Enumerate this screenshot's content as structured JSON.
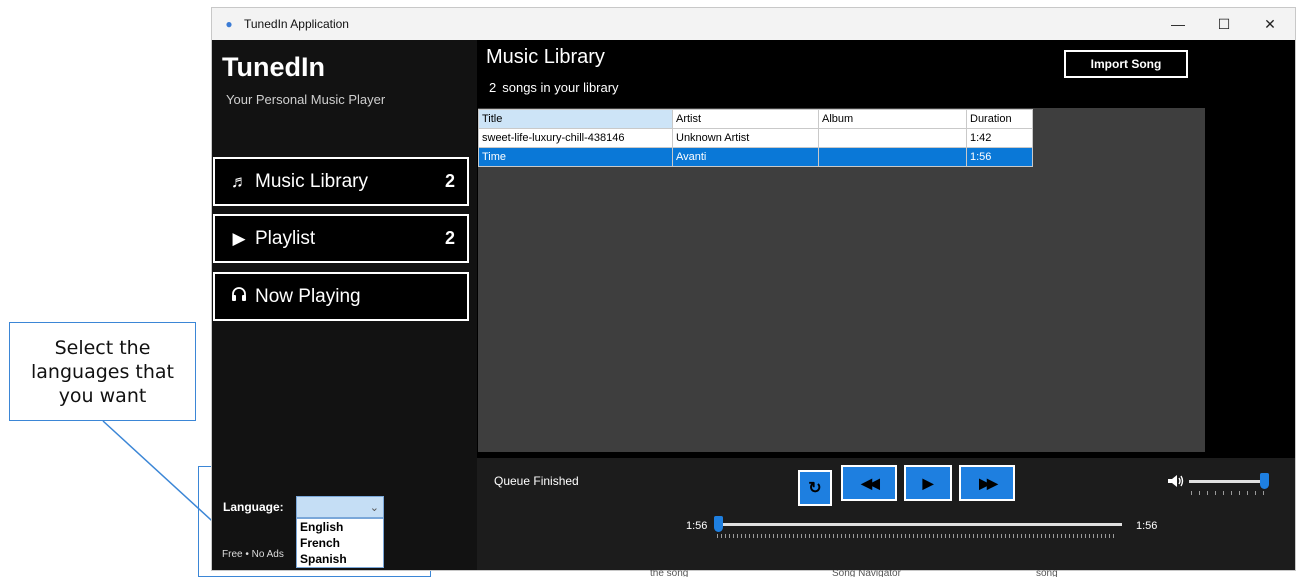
{
  "callout": {
    "text": "Select the languages that you want"
  },
  "window": {
    "title": "TunedIn Application",
    "controls": {
      "minimize": "—",
      "maximize": "☐",
      "close": "✕"
    }
  },
  "sidebar": {
    "brand": "TunedIn",
    "tagline": "Your Personal Music Player",
    "nav": [
      {
        "icon": "music-note-icon",
        "glyph": "♬",
        "label": "Music Library",
        "count": "2"
      },
      {
        "icon": "play-icon",
        "glyph": "▶",
        "label": "Playlist",
        "count": "2"
      },
      {
        "icon": "headphones-icon",
        "glyph": "🎧",
        "label": "Now Playing",
        "count": ""
      }
    ],
    "language": {
      "label": "Language:",
      "selected": "",
      "options": [
        "English",
        "French",
        "Spanish"
      ]
    },
    "footnote": "Free • No Ads"
  },
  "library": {
    "title": "Music Library",
    "count": "2",
    "count_text": "songs in your library",
    "import_label": "Import Song",
    "columns": [
      "Title",
      "Artist",
      "Album",
      "Duration"
    ],
    "rows": [
      {
        "title": "sweet-life-luxury-chill-438146",
        "artist": "Unknown Artist",
        "album": "",
        "duration": "1:42",
        "selected": false
      },
      {
        "title": "Time",
        "artist": "Avanti",
        "album": "",
        "duration": "1:56",
        "selected": true
      }
    ]
  },
  "player": {
    "status": "Queue Finished",
    "current_time": "1:56",
    "total_time": "1:56",
    "seek_fraction": 0.0,
    "volume_fraction": 1.0,
    "controls": [
      {
        "name": "repeat-button",
        "icon": "repeat-icon",
        "glyph": "↻"
      },
      {
        "name": "previous-button",
        "icon": "rewind-icon",
        "glyph": "◀◀"
      },
      {
        "name": "play-button",
        "icon": "play-icon",
        "glyph": "▶"
      },
      {
        "name": "next-button",
        "icon": "fast-forward-icon",
        "glyph": "▶▶"
      }
    ],
    "volume_icon": "speaker-icon"
  },
  "background": {
    "fragments": [
      "the song",
      "Song Navigator",
      "song"
    ]
  },
  "colors": {
    "accent": "#1e7fe0",
    "selection": "#0a78d7",
    "window_bg": "#000000",
    "sidebar_bg": "#121212",
    "grid_bg": "#3e3e3e"
  }
}
